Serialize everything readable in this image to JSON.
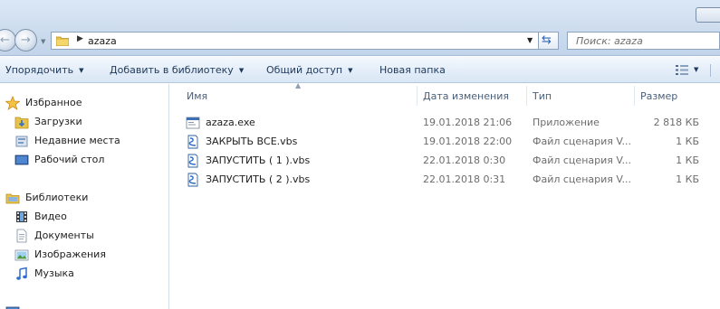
{
  "window": {
    "address": {
      "path_segment": "azaza"
    },
    "search": {
      "placeholder": "Поиск: azaza"
    }
  },
  "toolbar": {
    "organize_label": "Упорядочить",
    "add_to_library_label": "Добавить в библиотеку",
    "share_label": "Общий доступ",
    "new_folder_label": "Новая папка"
  },
  "navigation": {
    "favorites": {
      "label": "Избранное",
      "items": [
        {
          "label": "Загрузки",
          "icon": "downloads-icon"
        },
        {
          "label": "Недавние места",
          "icon": "recent-places-icon"
        },
        {
          "label": "Рабочий стол",
          "icon": "desktop-icon"
        }
      ]
    },
    "libraries": {
      "label": "Библиотеки",
      "items": [
        {
          "label": "Видео",
          "icon": "video-icon"
        },
        {
          "label": "Документы",
          "icon": "documents-icon"
        },
        {
          "label": "Изображения",
          "icon": "pictures-icon"
        },
        {
          "label": "Музыка",
          "icon": "music-icon"
        }
      ]
    }
  },
  "file_list": {
    "columns": {
      "name": "Имя",
      "date": "Дата изменения",
      "type": "Тип",
      "size": "Размер"
    },
    "files": [
      {
        "name": "azaza.exe",
        "date": "19.01.2018 21:06",
        "type": "Приложение",
        "size": "2 818 КБ",
        "icon": "exe-icon"
      },
      {
        "name": "ЗАКРЫТЬ ВСЕ.vbs",
        "date": "19.01.2018 22:00",
        "type": "Файл сценария V...",
        "size": "1 КБ",
        "icon": "vbs-script-icon"
      },
      {
        "name": "ЗАПУСТИТЬ ( 1 ).vbs",
        "date": "22.01.2018 0:30",
        "type": "Файл сценария V...",
        "size": "1 КБ",
        "icon": "vbs-script-icon"
      },
      {
        "name": "ЗАПУСТИТЬ ( 2 ).vbs",
        "date": "22.01.2018 0:31",
        "type": "Файл сценария V...",
        "size": "1 КБ",
        "icon": "vbs-script-icon"
      }
    ]
  },
  "colors": {
    "frame": "#cddcee",
    "command_text": "#1e395b",
    "header_text": "#4c607a",
    "meta_text": "#6d6d6d",
    "folder_yellow": "#e8c34a"
  }
}
